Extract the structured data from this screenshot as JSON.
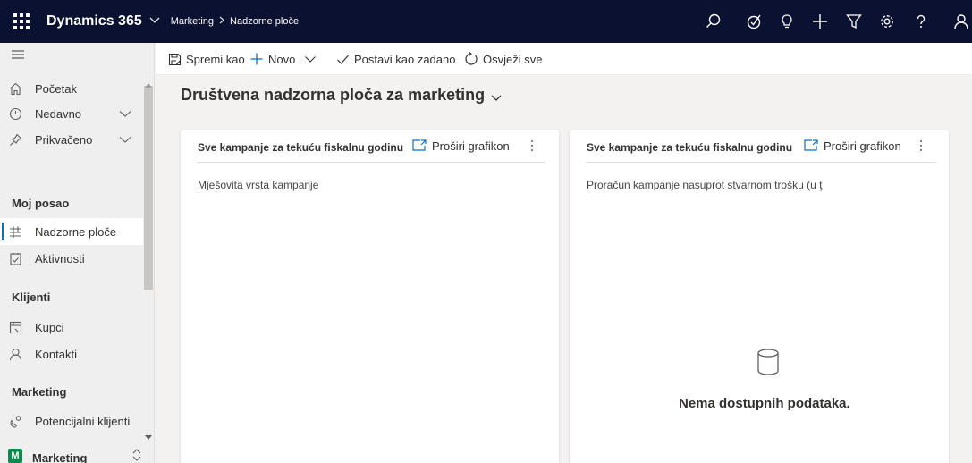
{
  "topbar": {
    "app_name": "Dynamics 365",
    "breadcrumb": [
      "Marketing",
      "Nadzorne ploče"
    ],
    "icons": [
      "search-icon",
      "assistant-icon",
      "lightbulb-icon",
      "plus-icon",
      "filter-icon",
      "settings-icon",
      "help-icon",
      "user-icon"
    ],
    "background": "#0b1130"
  },
  "sidebar": {
    "items_top": [
      {
        "label": "Početak",
        "icon": "home-icon"
      },
      {
        "label": "Nedavno",
        "icon": "clock-icon"
      },
      {
        "label": "Prikvačeno",
        "icon": "pin-icon"
      }
    ],
    "section_work": "Moj posao",
    "items_work": [
      {
        "label": "Nadzorne ploče",
        "icon": "dashboard-icon",
        "active": true
      },
      {
        "label": "Aktivnosti",
        "icon": "activities-icon"
      }
    ],
    "section_clients": "Klijenti",
    "items_clients": [
      {
        "label": "Kupci",
        "icon": "accounts-icon"
      },
      {
        "label": "Kontakti",
        "icon": "contact-icon"
      }
    ],
    "section_marketing": "Marketing",
    "items_marketing": [
      {
        "label": "Potencijalni klijenti",
        "icon": "leads-icon"
      }
    ],
    "area": {
      "badge": "M",
      "label": "Marketing"
    }
  },
  "commandbar": {
    "save_as": "Spremi kao",
    "new": "Novo",
    "set_default": "Postavi kao zadano",
    "refresh_all": "Osvježi sve"
  },
  "main": {
    "title": "Društvena nadzorna ploča za marketing",
    "cards": [
      {
        "title": "Sve kampanje za tekuću fiskalnu godinu",
        "expand": "Proširi grafikon",
        "subtitle": "Mješovita vrsta kampanje"
      },
      {
        "title": "Sve kampanje za tekuću fiskalnu godinu",
        "expand": "Proširi grafikon",
        "subtitle": "Proračun kampanje nasuprot stvarnom trošku (u ţ",
        "no_data": "Nema dostupnih podataka."
      }
    ]
  },
  "colors": {
    "accent": "#0f6cbd",
    "area_badge": "#0b8a4b"
  }
}
